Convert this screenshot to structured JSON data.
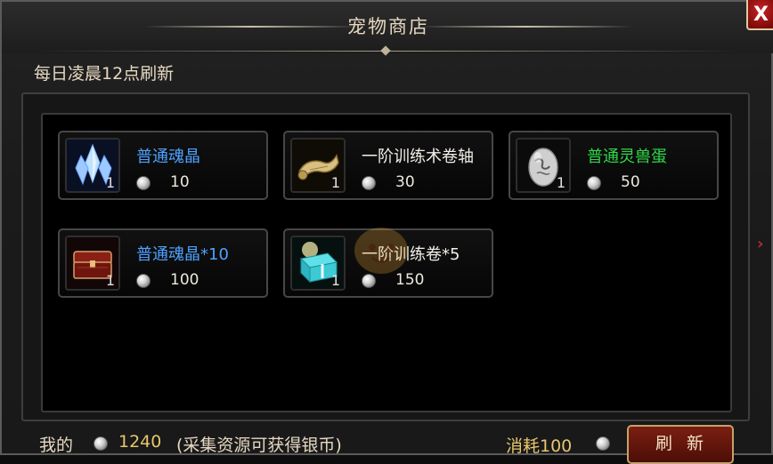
{
  "window": {
    "title": "宠物商店",
    "close_label": "X"
  },
  "shop": {
    "refresh_note": "每日凌晨12点刷新",
    "items": [
      {
        "name": "普通魂晶",
        "qty": "1",
        "price": "10",
        "name_color": "#4ea1ff",
        "icon": "crystal-icon"
      },
      {
        "name": "一阶训练术卷轴",
        "qty": "1",
        "price": "30",
        "name_color": "#f2efe8",
        "icon": "scroll-icon"
      },
      {
        "name": "普通灵兽蛋",
        "qty": "1",
        "price": "50",
        "name_color": "#2fd84a",
        "icon": "egg-icon"
      },
      {
        "name": "普通魂晶*10",
        "qty": "1",
        "price": "100",
        "name_color": "#4ea1ff",
        "icon": "chest-icon"
      },
      {
        "name": "一阶训练卷*5",
        "qty": "1",
        "price": "150",
        "name_color": "#f2efe8",
        "icon": "gift-box-icon"
      }
    ]
  },
  "footer": {
    "mine_label": "我的",
    "silver_amount": "1240",
    "silver_hint": "(采集资源可获得银币)",
    "cost_label": "消耗100",
    "refresh_button": "刷新"
  },
  "colors": {
    "gold_text": "#e7c56c",
    "blue_item": "#4ea1ff",
    "green_item": "#2fd84a"
  }
}
